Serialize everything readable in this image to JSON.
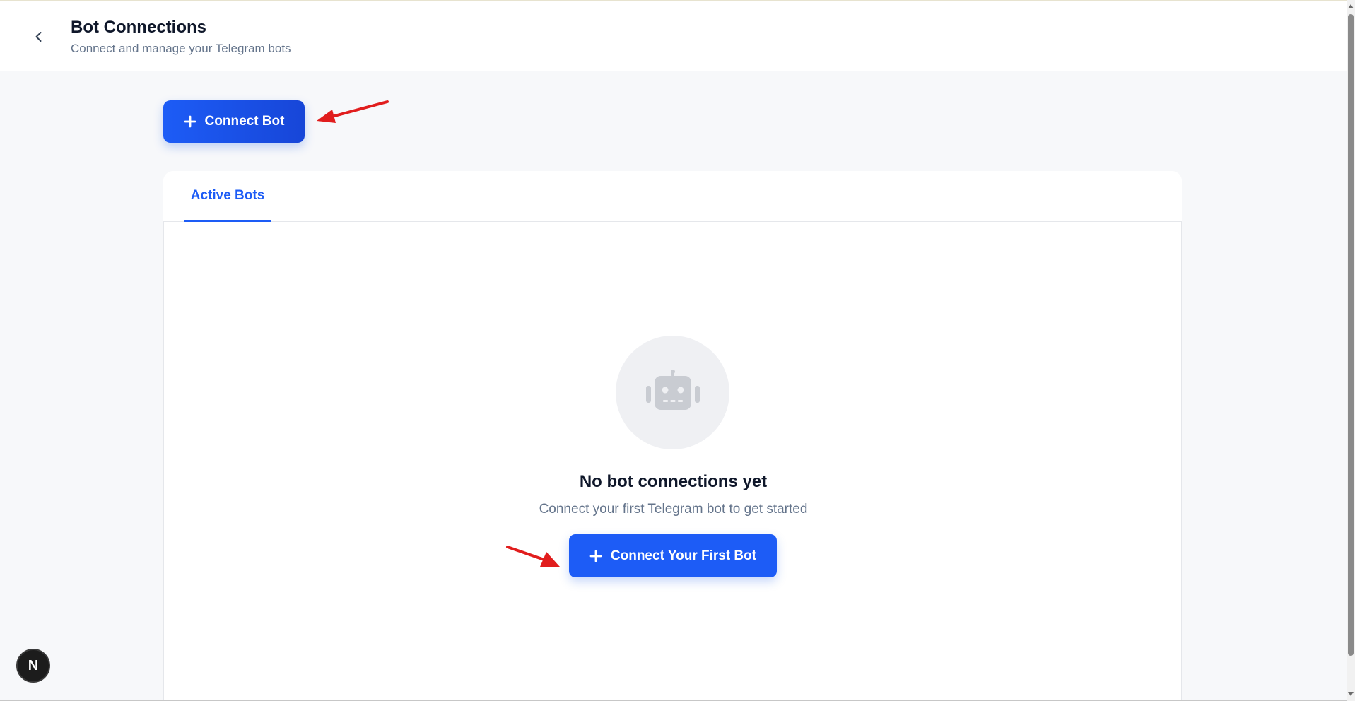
{
  "header": {
    "title": "Bot Connections",
    "subtitle": "Connect and manage your Telegram bots",
    "back_icon": "chevron-left-icon"
  },
  "toolbar": {
    "connect_bot_label": "Connect Bot",
    "connect_bot_icon": "plus-icon"
  },
  "tabs": [
    {
      "label": "Active Bots",
      "active": true
    }
  ],
  "empty_state": {
    "icon": "robot-icon",
    "title": "No bot connections yet",
    "subtitle": "Connect your first Telegram bot to get started",
    "button_label": "Connect Your First Bot",
    "button_icon": "plus-icon"
  },
  "dev_badge": {
    "label": "N"
  },
  "colors": {
    "primary": "#1d5cf6",
    "annotation_arrow": "#e11d1d",
    "page_bg": "#f7f8fa",
    "title_text": "#0f172a",
    "muted_text": "#64748b"
  }
}
